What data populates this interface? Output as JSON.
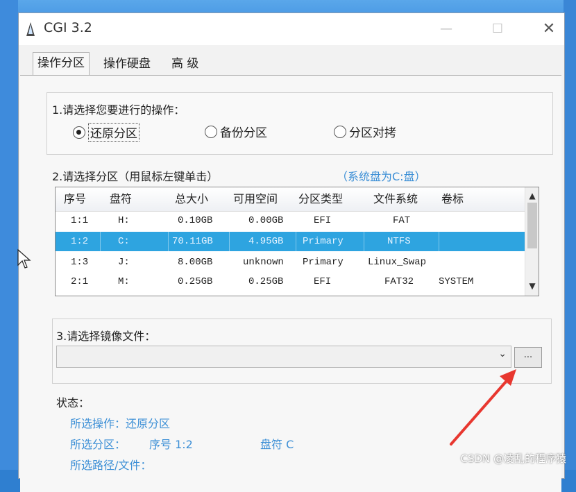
{
  "window": {
    "title": "CGI 3.2",
    "controls": {
      "minimize": "—",
      "maximize": "☐",
      "close": "✕"
    }
  },
  "tabs": [
    {
      "label": "操作分区",
      "active": true
    },
    {
      "label": "操作硬盘",
      "active": false
    },
    {
      "label": "高 级",
      "active": false
    }
  ],
  "section1": {
    "label": "1.请选择您要进行的操作：",
    "options": [
      {
        "label": "还原分区",
        "selected": true
      },
      {
        "label": "备份分区",
        "selected": false
      },
      {
        "label": "分区对拷",
        "selected": false
      }
    ]
  },
  "section2": {
    "label": "2.请选择分区（用鼠标左键单击）",
    "hint": "（系统盘为C:盘）",
    "columns": [
      "序号",
      "盘符",
      "总大小",
      "可用空间",
      "分区类型",
      "文件系统",
      "卷标"
    ],
    "rows": [
      {
        "cells": [
          "1:1",
          "H:",
          "0.10GB",
          "0.00GB",
          "EFI",
          "FAT",
          ""
        ],
        "selected": false
      },
      {
        "cells": [
          "1:2",
          "C:",
          "70.11GB",
          "4.95GB",
          "Primary",
          "NTFS",
          ""
        ],
        "selected": true
      },
      {
        "cells": [
          "1:3",
          "J:",
          "8.00GB",
          "unknown",
          "Primary",
          "Linux_Swap",
          ""
        ],
        "selected": false
      },
      {
        "cells": [
          "2:1",
          "M:",
          "0.25GB",
          "0.25GB",
          "EFI",
          "FAT32",
          "SYSTEM"
        ],
        "selected": false
      }
    ]
  },
  "section3": {
    "label": "3.请选择镜像文件：",
    "value": "",
    "browse_label": "..."
  },
  "status": {
    "label": "状态：",
    "operation": "所选操作：还原分区",
    "partition_prefix": "所选分区：",
    "partition_seq": "序号 1:2",
    "partition_drive": "盘符 C",
    "path": "所选路径/文件："
  },
  "watermark": "CSDN @凌乱的程序猿",
  "colors": {
    "selection": "#2ea4e0",
    "hint": "#3c8fd6",
    "annotation_arrow": "#e8372f"
  }
}
